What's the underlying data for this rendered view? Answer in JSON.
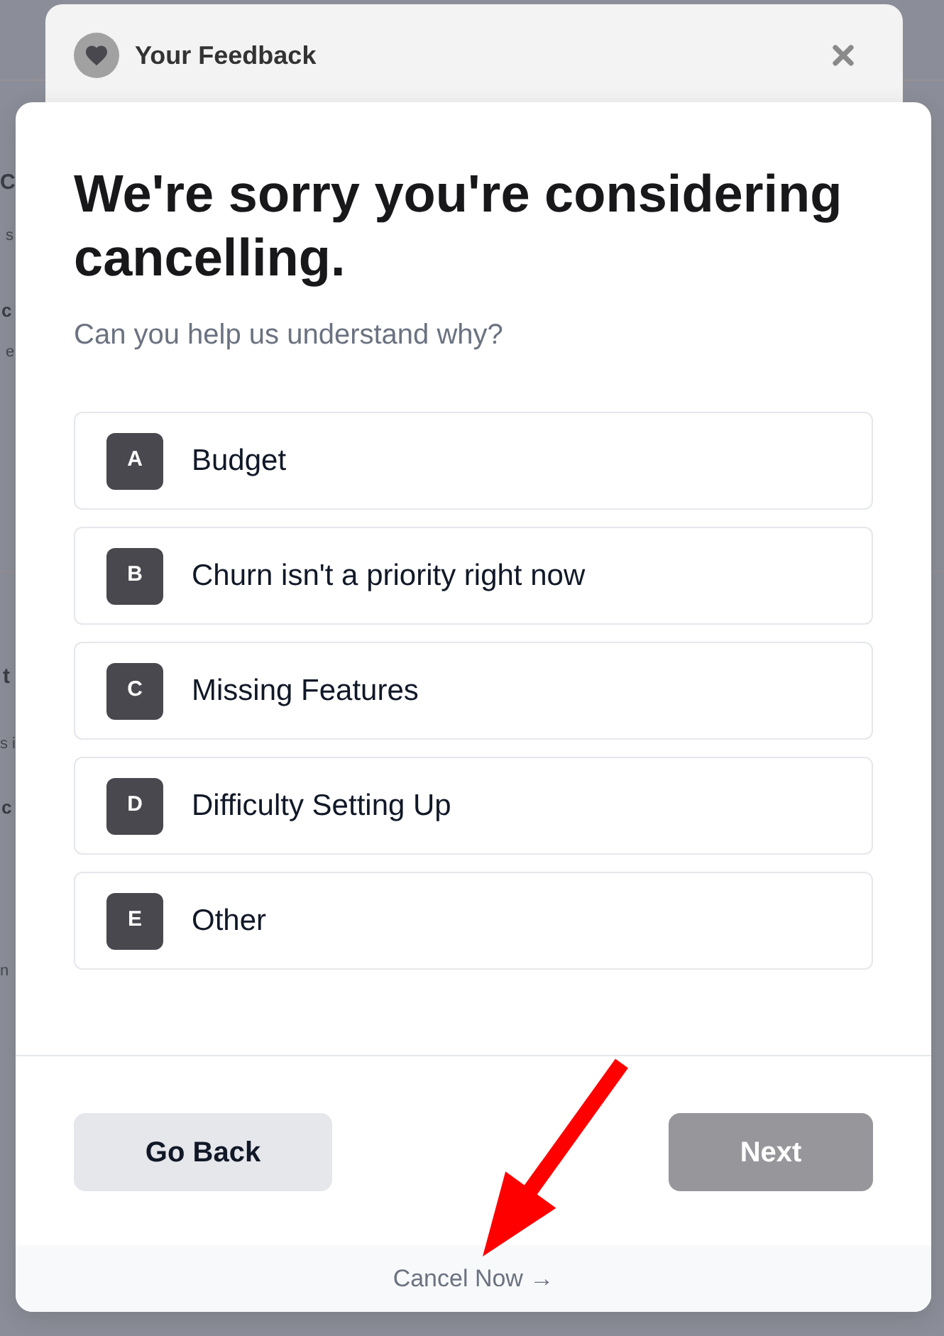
{
  "background_page": {
    "fragments": [
      {
        "text": "C",
        "kind": "heading"
      },
      {
        "text": "s",
        "kind": "body"
      },
      {
        "text": "c",
        "kind": "label"
      },
      {
        "text": "e",
        "kind": "body"
      },
      {
        "text": "t",
        "kind": "heading"
      },
      {
        "text": "s i",
        "kind": "body"
      },
      {
        "text": "c",
        "kind": "label"
      },
      {
        "text": "n",
        "kind": "body"
      }
    ]
  },
  "header": {
    "title": "Your Feedback"
  },
  "question": {
    "title": "We're sorry you're considering cancelling.",
    "subtitle": "Can you help us understand why?"
  },
  "options": [
    {
      "key": "A",
      "label": "Budget",
      "selected": false
    },
    {
      "key": "B",
      "label": "Churn isn't a priority right now",
      "selected": false
    },
    {
      "key": "C",
      "label": "Missing Features",
      "selected": false
    },
    {
      "key": "D",
      "label": "Difficulty Setting Up",
      "selected": false
    },
    {
      "key": "E",
      "label": "Other",
      "selected": false
    }
  ],
  "actions": [
    {
      "label": "Go Back",
      "kind": "secondary",
      "disabled": false
    },
    {
      "label": "Next",
      "kind": "primary",
      "disabled": true
    }
  ],
  "footer_link": {
    "label": "Cancel Now →"
  }
}
